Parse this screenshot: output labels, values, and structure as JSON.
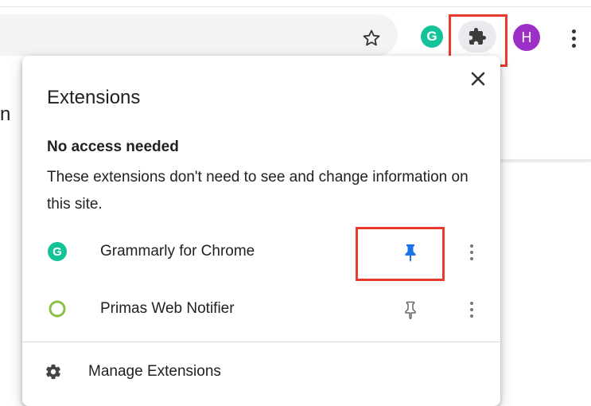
{
  "toolbar": {
    "avatar_initial": "H",
    "grammarly_initial": "G"
  },
  "background_page": {
    "partial_text": "n"
  },
  "popup": {
    "title": "Extensions",
    "section_title": "No access needed",
    "section_description": "These extensions don't need to see and change information on this site.",
    "extensions": [
      {
        "name": "Grammarly for Chrome",
        "icon": "grammarly-icon",
        "pinned": true,
        "icon_letter": "G"
      },
      {
        "name": "Primas Web Notifier",
        "icon": "primas-icon",
        "pinned": false
      }
    ],
    "manage_label": "Manage Extensions"
  },
  "colors": {
    "highlight": "#e83b2d",
    "grammarly": "#15c39a",
    "avatar": "#9c2fc6",
    "pin_active": "#1a73e8",
    "primas": "#8bc34a"
  }
}
